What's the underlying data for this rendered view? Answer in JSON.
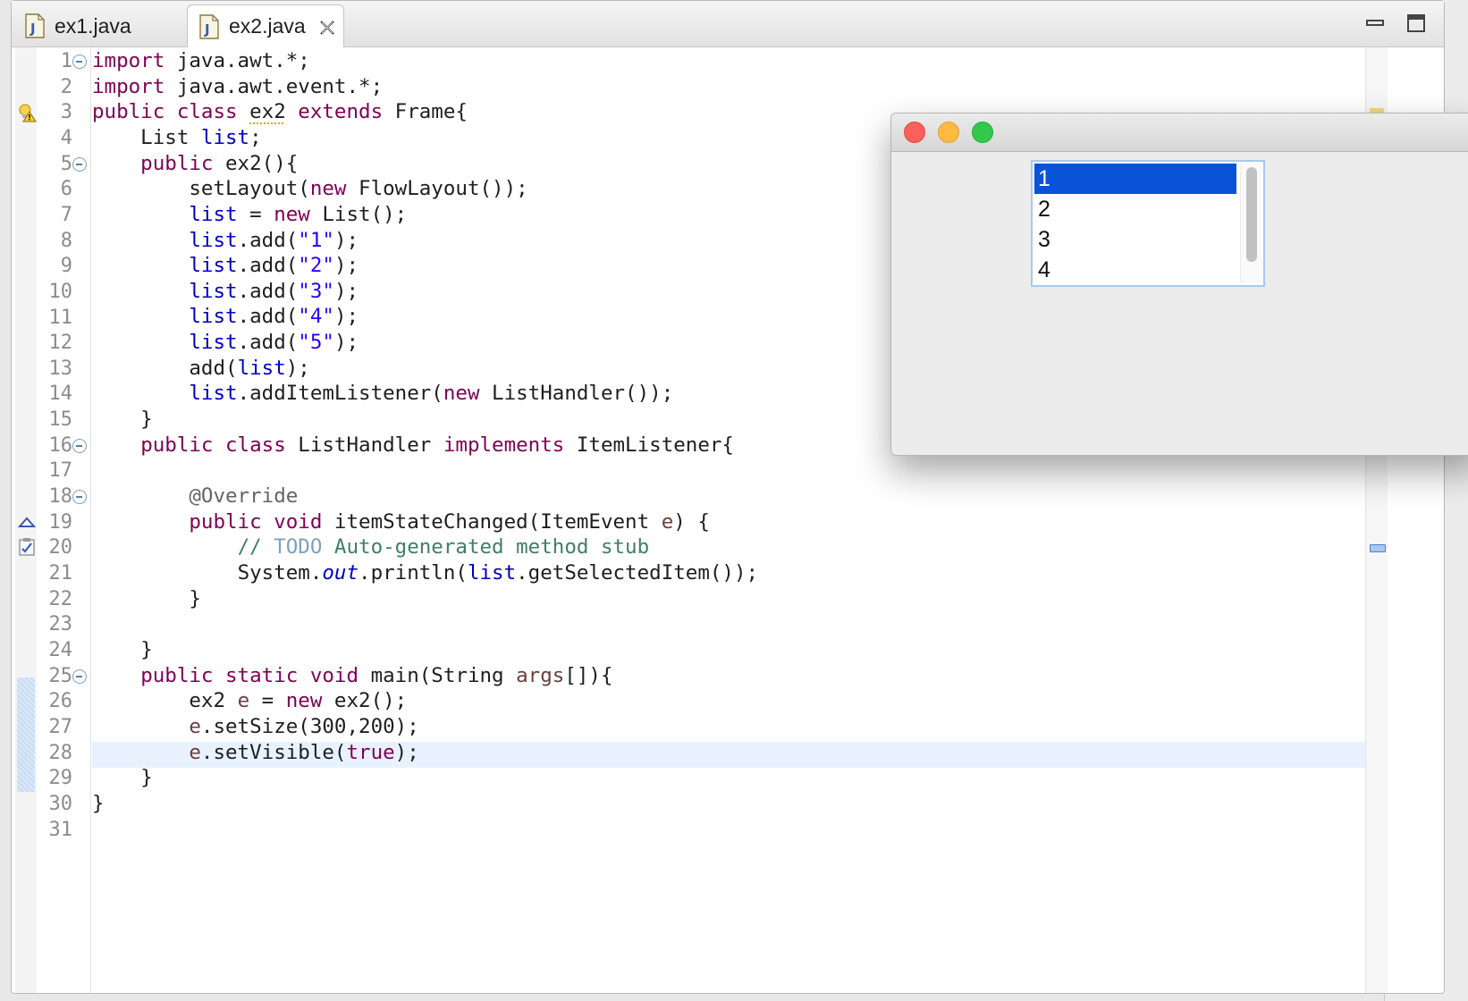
{
  "tabs": [
    {
      "label": "ex1.java",
      "active": false
    },
    {
      "label": "ex2.java",
      "active": true
    }
  ],
  "code_lines": [
    {
      "num": "1"
    },
    {
      "num": "2"
    },
    {
      "num": "3"
    },
    {
      "num": "4"
    },
    {
      "num": "5"
    },
    {
      "num": "6"
    },
    {
      "num": "7"
    },
    {
      "num": "8"
    },
    {
      "num": "9"
    },
    {
      "num": "10"
    },
    {
      "num": "11"
    },
    {
      "num": "12"
    },
    {
      "num": "13"
    },
    {
      "num": "14"
    },
    {
      "num": "15"
    },
    {
      "num": "16"
    },
    {
      "num": "17"
    },
    {
      "num": "18"
    },
    {
      "num": "19"
    },
    {
      "num": "20"
    },
    {
      "num": "21"
    },
    {
      "num": "22"
    },
    {
      "num": "23"
    },
    {
      "num": "24"
    },
    {
      "num": "25"
    },
    {
      "num": "26"
    },
    {
      "num": "27"
    },
    {
      "num": "28"
    },
    {
      "num": "29"
    },
    {
      "num": "30"
    },
    {
      "num": "31"
    }
  ],
  "code": {
    "l1": {
      "kw": "import",
      "rest": " java.awt.*;"
    },
    "l2": {
      "kw": "import",
      "rest": " java.awt.event.*;"
    },
    "l3": {
      "kw1": "public",
      "kw2": "class",
      "name": "ex2",
      "kw3": "extends",
      "rest": " Frame{"
    },
    "l4": {
      "type": "    List ",
      "field": "list",
      "rest": ";"
    },
    "l5": {
      "kw": "    public",
      "rest": " ex2(){"
    },
    "l6": {
      "pre": "        setLayout(",
      "kw": "new",
      "rest": " FlowLayout());"
    },
    "l7": {
      "field": "list",
      "mid": " = ",
      "kw": "new",
      "rest": " List();"
    },
    "l8": {
      "field": "list",
      "mid": ".add(",
      "str": "\"1\"",
      "rest": ");"
    },
    "l9": {
      "field": "list",
      "mid": ".add(",
      "str": "\"2\"",
      "rest": ");"
    },
    "l10": {
      "field": "list",
      "mid": ".add(",
      "str": "\"3\"",
      "rest": ");"
    },
    "l11": {
      "field": "list",
      "mid": ".add(",
      "str": "\"4\"",
      "rest": ");"
    },
    "l12": {
      "field": "list",
      "mid": ".add(",
      "str": "\"5\"",
      "rest": ");"
    },
    "l13": {
      "pre": "add(",
      "field": "list",
      "rest": ");"
    },
    "l14": {
      "field": "list",
      "mid": ".addItemListener(",
      "kw": "new",
      "rest": " ListHandler());"
    },
    "l15": {
      "text": "    }"
    },
    "l16": {
      "kw1": "public",
      "kw2": "class",
      "name": " ListHandler ",
      "kw3": "implements",
      "rest": " ItemListener{"
    },
    "l18": {
      "ann": "@Override"
    },
    "l19": {
      "kw1": "public",
      "kw2": "void",
      "mid": " itemStateChanged(ItemEvent ",
      "prm": "e",
      "rest": ") {"
    },
    "l20": {
      "cmt1": "// ",
      "todo": "TODO",
      "cmt2": " Auto-generated method stub"
    },
    "l21": {
      "pre": "System.",
      "sfld": "out",
      "mid": ".println(",
      "field": "list",
      "rest": ".getSelectedItem());"
    },
    "l22": {
      "text": "}"
    },
    "l24": {
      "text": "}"
    },
    "l25": {
      "kw1": "public",
      "kw2": "static",
      "kw3": "void",
      "mid": " main(String ",
      "prm": "args",
      "rest": "[]){"
    },
    "l26": {
      "pre": "ex2 ",
      "prm": "e",
      "mid": " = ",
      "kw": "new",
      "rest": " ex2();"
    },
    "l27": {
      "prm": "e",
      "rest": ".setSize(300,200);"
    },
    "l28": {
      "prm": "e",
      "mid": ".setVisible(",
      "kw": "true",
      "rest": ");"
    },
    "l29": {
      "text": "}"
    },
    "l30": {
      "text": "}"
    }
  },
  "awt_window": {
    "list_items": [
      "1",
      "2",
      "3",
      "4"
    ],
    "selected_index": 0
  },
  "colors": {
    "keyword": "#7f0055",
    "field": "#0000c0",
    "string": "#2a00ff",
    "comment": "#3f7f5f",
    "selection": "#0953d6"
  }
}
